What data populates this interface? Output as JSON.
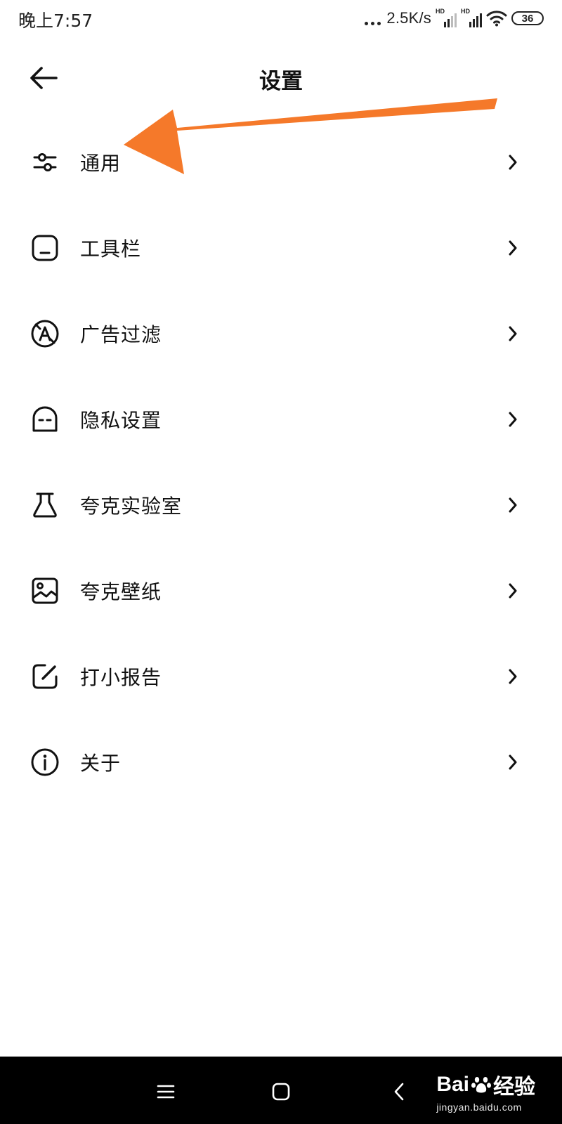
{
  "status_bar": {
    "time": "晚上7:57",
    "net_speed": "2.5K/s",
    "sim1_tag": "HD",
    "sim2_tag": "HD",
    "battery": "36"
  },
  "header": {
    "back_icon": "arrow-left-icon",
    "title": "设置"
  },
  "menu": {
    "items": [
      {
        "label": "通用",
        "icon": "sliders-icon"
      },
      {
        "label": "工具栏",
        "icon": "toolbar-icon"
      },
      {
        "label": "广告过滤",
        "icon": "ad-block-icon"
      },
      {
        "label": "隐私设置",
        "icon": "privacy-mask-icon"
      },
      {
        "label": "夸克实验室",
        "icon": "flask-icon"
      },
      {
        "label": "夸克壁纸",
        "icon": "image-icon"
      },
      {
        "label": "打小报告",
        "icon": "feedback-edit-icon"
      },
      {
        "label": "关于",
        "icon": "info-icon"
      }
    ],
    "chevron_icon": "chevron-right-icon"
  },
  "annotation": {
    "color": "#F5792A"
  },
  "nav_bar": {
    "menu_icon": "menu-icon",
    "home_icon": "home-square-icon",
    "back_icon": "back-triangle-icon"
  },
  "watermark": {
    "brand": "Bai",
    "brand_suffix": "经验",
    "url": "jingyan.baidu.com"
  }
}
